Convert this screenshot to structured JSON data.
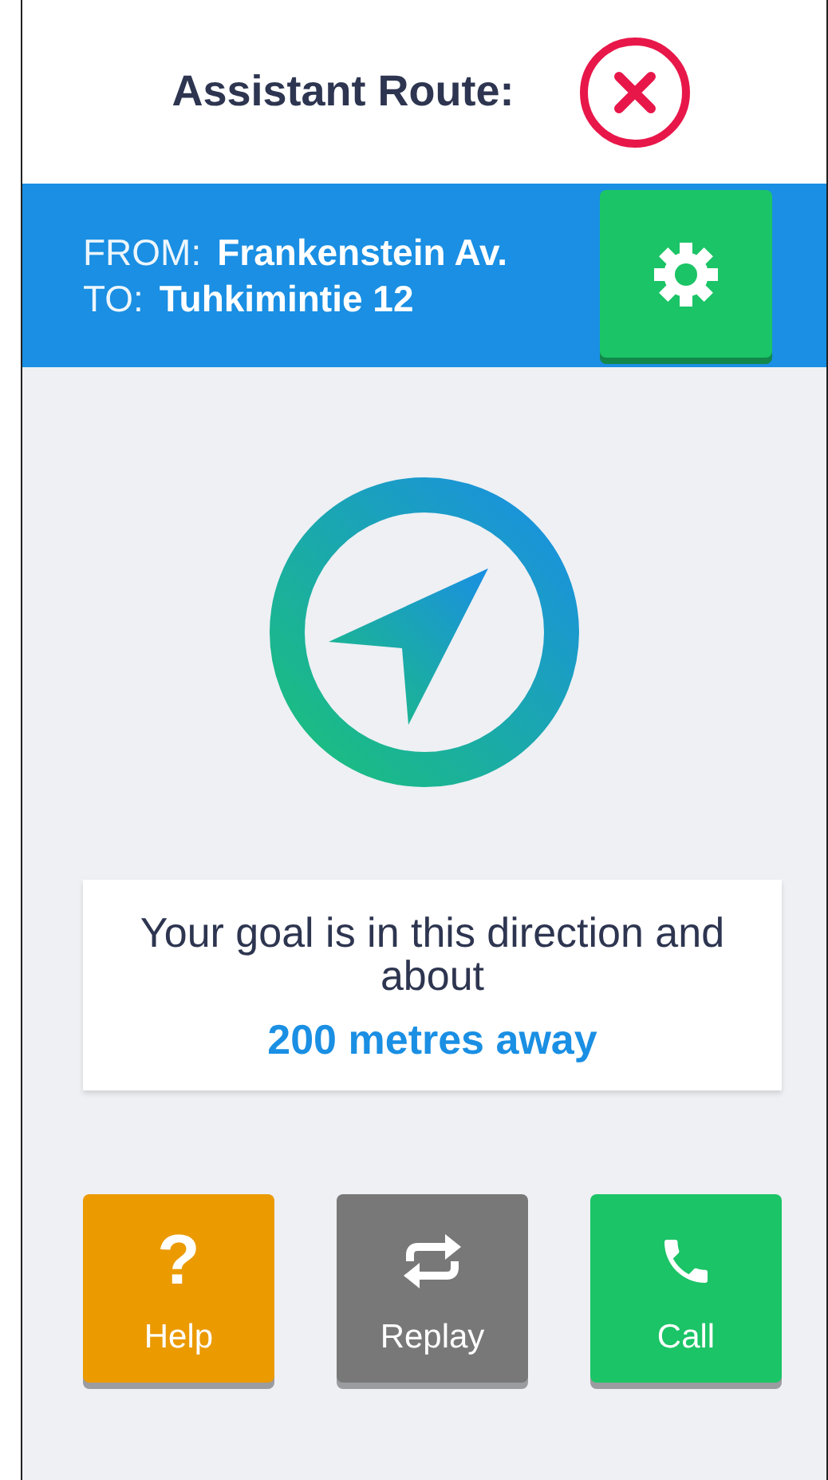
{
  "header": {
    "title": "Assistant Route:"
  },
  "route": {
    "from_label": "FROM:",
    "from": "Frankenstein Av.",
    "to_label": "TO:",
    "to": "Tuhkimintie 12"
  },
  "message": {
    "text": "Your goal is in this direction and about",
    "distance": "200 metres away"
  },
  "actions": [
    {
      "kind": "help",
      "label": "Help",
      "icon": "?",
      "color": "#eb9a00"
    },
    {
      "kind": "replay",
      "label": "Replay",
      "color": "#787878"
    },
    {
      "kind": "call",
      "label": "Call",
      "color": "#1bc466"
    }
  ]
}
